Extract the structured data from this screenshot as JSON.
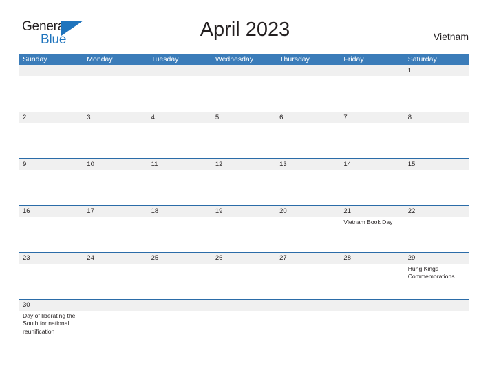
{
  "brand": {
    "name_part1": "General",
    "name_part2": "Blue",
    "triangle_color": "#1f74bd",
    "text_color": "#231f20"
  },
  "header": {
    "title": "April 2023",
    "country": "Vietnam"
  },
  "theme": {
    "header_blue": "#3b7cb9",
    "rule_blue": "#2b6ca8",
    "daynum_band": "#f0f0f0",
    "page_background": "#ffffff",
    "text": "#231f20"
  },
  "weekdays": [
    "Sunday",
    "Monday",
    "Tuesday",
    "Wednesday",
    "Thursday",
    "Friday",
    "Saturday"
  ],
  "weeks": [
    {
      "days": [
        {
          "num": "",
          "events": []
        },
        {
          "num": "",
          "events": []
        },
        {
          "num": "",
          "events": []
        },
        {
          "num": "",
          "events": []
        },
        {
          "num": "",
          "events": []
        },
        {
          "num": "",
          "events": []
        },
        {
          "num": "1",
          "events": []
        }
      ]
    },
    {
      "days": [
        {
          "num": "2",
          "events": []
        },
        {
          "num": "3",
          "events": []
        },
        {
          "num": "4",
          "events": []
        },
        {
          "num": "5",
          "events": []
        },
        {
          "num": "6",
          "events": []
        },
        {
          "num": "7",
          "events": []
        },
        {
          "num": "8",
          "events": []
        }
      ]
    },
    {
      "days": [
        {
          "num": "9",
          "events": []
        },
        {
          "num": "10",
          "events": []
        },
        {
          "num": "11",
          "events": []
        },
        {
          "num": "12",
          "events": []
        },
        {
          "num": "13",
          "events": []
        },
        {
          "num": "14",
          "events": []
        },
        {
          "num": "15",
          "events": []
        }
      ]
    },
    {
      "days": [
        {
          "num": "16",
          "events": []
        },
        {
          "num": "17",
          "events": []
        },
        {
          "num": "18",
          "events": []
        },
        {
          "num": "19",
          "events": []
        },
        {
          "num": "20",
          "events": []
        },
        {
          "num": "21",
          "events": [
            "Vietnam Book Day"
          ]
        },
        {
          "num": "22",
          "events": []
        }
      ]
    },
    {
      "days": [
        {
          "num": "23",
          "events": []
        },
        {
          "num": "24",
          "events": []
        },
        {
          "num": "25",
          "events": []
        },
        {
          "num": "26",
          "events": []
        },
        {
          "num": "27",
          "events": []
        },
        {
          "num": "28",
          "events": []
        },
        {
          "num": "29",
          "events": [
            "Hung Kings Commemorations"
          ]
        }
      ]
    },
    {
      "days": [
        {
          "num": "30",
          "events": [
            "Day of liberating the South for national reunification"
          ]
        },
        {
          "num": "",
          "events": []
        },
        {
          "num": "",
          "events": []
        },
        {
          "num": "",
          "events": []
        },
        {
          "num": "",
          "events": []
        },
        {
          "num": "",
          "events": []
        },
        {
          "num": "",
          "events": []
        }
      ]
    }
  ]
}
